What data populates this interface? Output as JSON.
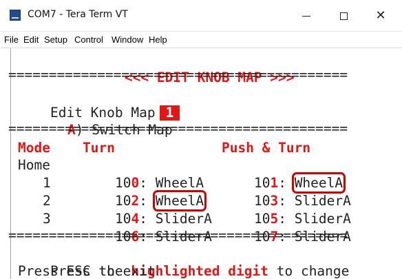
{
  "window": {
    "title": "COM7 - Tera Term VT",
    "icon_label": "VT",
    "controls": {
      "minimize_icon": "minimize-icon",
      "maximize_icon": "maximize-icon",
      "close_icon": "close-icon",
      "close_glyph": "✕"
    }
  },
  "menu": [
    "File",
    "Edit",
    "Setup",
    "Control",
    "Window",
    "Help"
  ],
  "terminal": {
    "header": "<<< EDIT KNOB MAP >>>",
    "separator": "==========================================",
    "edit_label": "Edit Knob Map",
    "map_number": "1",
    "switch_key": "A",
    "switch_text": ") Switch Map",
    "col_mode": "Mode",
    "col_turn": "Turn",
    "col_push_turn": "Push & Turn",
    "rows": [
      {
        "mode": "Home",
        "turn_prefix": "10",
        "turn_digit": "0",
        "turn_name": "WheelA",
        "push_prefix": "10",
        "push_digit": "1",
        "push_name": "WheelA"
      },
      {
        "mode": "1",
        "turn_prefix": "10",
        "turn_digit": "2",
        "turn_name": "WheelA",
        "push_prefix": "10",
        "push_digit": "3",
        "push_name": "SliderA"
      },
      {
        "mode": "2",
        "turn_prefix": "10",
        "turn_digit": "4",
        "turn_name": "SliderA",
        "push_prefix": "10",
        "push_digit": "5",
        "push_name": "SliderA"
      },
      {
        "mode": "3",
        "turn_prefix": "10",
        "turn_digit": "6",
        "turn_name": "SliderA",
        "push_prefix": "10",
        "push_digit": "7",
        "push_name": "SliderA"
      }
    ],
    "footer_press": "Press the",
    "footer_highlight": "highlighted digit",
    "footer_change": "to change",
    "footer_exit": "Press ESC to exit"
  },
  "colors": {
    "accent_red": "#e31616",
    "box_red": "#d30000"
  }
}
